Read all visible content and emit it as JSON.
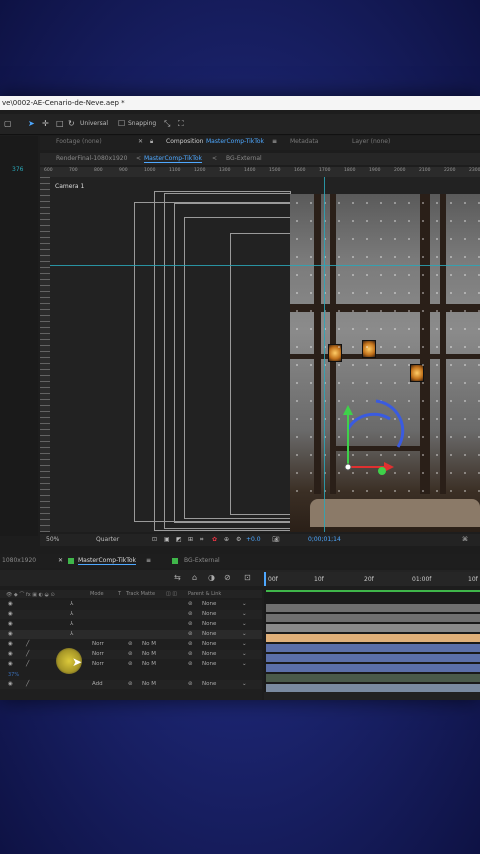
{
  "window": {
    "title": "ve\\0002-AE-Cenario-de-Neve.aep *"
  },
  "toolbar": {
    "mode": "Universal",
    "snapping": "Snapping"
  },
  "panel_tabs": {
    "footage": "Footage (none)",
    "composition_label": "Composition",
    "composition_name": "MasterComp-TikTok",
    "metadata": "Metadata",
    "layer": "Layer (none)"
  },
  "viewer_tabs": {
    "render": "RenderFinal-1080x1920",
    "master": "MasterComp-TikTok",
    "bg": "BG-External"
  },
  "ruler_marks": [
    "600",
    "700",
    "800",
    "900",
    "1000",
    "1100",
    "1200",
    "1300",
    "1400",
    "1500",
    "1600",
    "1700",
    "1800",
    "1900",
    "2000",
    "2100",
    "2200",
    "2300"
  ],
  "viewer": {
    "camera": "Camera 1",
    "zoom": "50%",
    "quality": "Quarter",
    "exposure": "+0.0",
    "timecode": "0;00;01;14"
  },
  "timeline_tabs": {
    "left": "1080x1920",
    "master": "MasterComp-TikTok",
    "bg": "BG-External"
  },
  "timeline_cols": {
    "mode": "Mode",
    "t": "T",
    "track_matte": "Track Matte",
    "parent": "Parent & Link"
  },
  "time_ruler": [
    "00f",
    "10f",
    "20f",
    "01:00f",
    "10f"
  ],
  "layers": [
    {
      "mode": "",
      "matte": "",
      "parent": "None"
    },
    {
      "mode": "",
      "matte": "",
      "parent": "None"
    },
    {
      "mode": "",
      "matte": "",
      "parent": "None"
    },
    {
      "mode": "",
      "matte": "",
      "parent": "None"
    },
    {
      "mode": "Norr",
      "matte": "No M",
      "parent": "None"
    },
    {
      "mode": "Norr",
      "matte": "No M",
      "parent": "None"
    },
    {
      "mode": "Norr",
      "matte": "No M",
      "parent": "None"
    },
    {
      "mode": "Add",
      "matte": "No M",
      "parent": "None"
    }
  ],
  "bottom_label": "37%",
  "colors": {
    "accent": "#2aa7b8",
    "layer_green": "#3fb64a",
    "layer_orange": "#e0b079",
    "layer_gray": "#6f6f6f",
    "layer_blue": "#5b6fa8"
  }
}
